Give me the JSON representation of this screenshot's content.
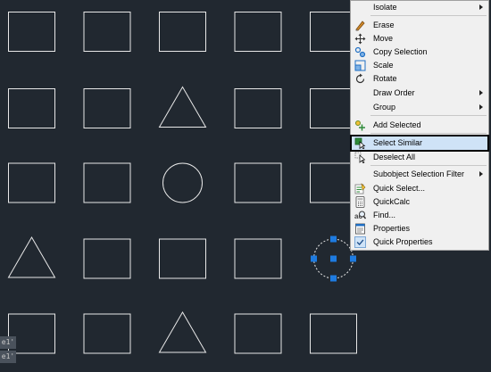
{
  "canvas": {
    "background": "#212830",
    "stroke": "#e8e8e8",
    "grip_color": "#1e7be0",
    "shapes": [
      {
        "kind": "rect",
        "row": 1,
        "col": 1
      },
      {
        "kind": "rect",
        "row": 1,
        "col": 2
      },
      {
        "kind": "rect",
        "row": 1,
        "col": 3
      },
      {
        "kind": "rect",
        "row": 1,
        "col": 4
      },
      {
        "kind": "rect",
        "row": 1,
        "col": 5
      },
      {
        "kind": "rect",
        "row": 2,
        "col": 1
      },
      {
        "kind": "rect",
        "row": 2,
        "col": 2
      },
      {
        "kind": "triangle",
        "row": 2,
        "col": 3
      },
      {
        "kind": "rect",
        "row": 2,
        "col": 4
      },
      {
        "kind": "rect",
        "row": 2,
        "col": 5
      },
      {
        "kind": "rect",
        "row": 3,
        "col": 1
      },
      {
        "kind": "rect",
        "row": 3,
        "col": 2
      },
      {
        "kind": "circle",
        "row": 3,
        "col": 3
      },
      {
        "kind": "rect",
        "row": 3,
        "col": 4
      },
      {
        "kind": "rect",
        "row": 3,
        "col": 5
      },
      {
        "kind": "triangle",
        "row": 4,
        "col": 1
      },
      {
        "kind": "rect",
        "row": 4,
        "col": 2
      },
      {
        "kind": "rect",
        "row": 4,
        "col": 3
      },
      {
        "kind": "rect",
        "row": 4,
        "col": 4
      },
      {
        "kind": "circle",
        "row": 4,
        "col": 5,
        "selected": true
      },
      {
        "kind": "rect",
        "row": 5,
        "col": 1
      },
      {
        "kind": "rect",
        "row": 5,
        "col": 2
      },
      {
        "kind": "triangle",
        "row": 5,
        "col": 3
      },
      {
        "kind": "rect",
        "row": 5,
        "col": 4
      },
      {
        "kind": "rect",
        "row": 5,
        "col": 5
      }
    ]
  },
  "side_glyphs": [
    "e1'",
    "e1'"
  ],
  "menu": {
    "items": [
      {
        "label": "Isolate",
        "icon": "none",
        "submenu": true
      },
      {
        "label": "Erase",
        "icon": "eraser-icon"
      },
      {
        "label": "Move",
        "icon": "move-arrows-icon"
      },
      {
        "label": "Copy Selection",
        "icon": "copy-selection-icon"
      },
      {
        "label": "Scale",
        "icon": "scale-icon"
      },
      {
        "label": "Rotate",
        "icon": "rotate-icon"
      },
      {
        "label": "Draw Order",
        "icon": "none",
        "submenu": true
      },
      {
        "label": "Group",
        "icon": "none",
        "submenu": true
      },
      {
        "label": "Add Selected",
        "icon": "add-selected-icon"
      },
      {
        "label": "Select Similar",
        "icon": "select-similar-icon",
        "highlighted": true
      },
      {
        "label": "Deselect All",
        "icon": "deselect-all-icon"
      },
      {
        "label": "Subobject Selection Filter",
        "icon": "none",
        "submenu": true
      },
      {
        "label": "Quick Select...",
        "icon": "quick-select-icon"
      },
      {
        "label": "QuickCalc",
        "icon": "calculator-icon"
      },
      {
        "label": "Find...",
        "icon": "find-icon"
      },
      {
        "label": "Properties",
        "icon": "properties-icon"
      },
      {
        "label": "Quick Properties",
        "icon": "checkmark-icon",
        "checked": true
      }
    ]
  }
}
